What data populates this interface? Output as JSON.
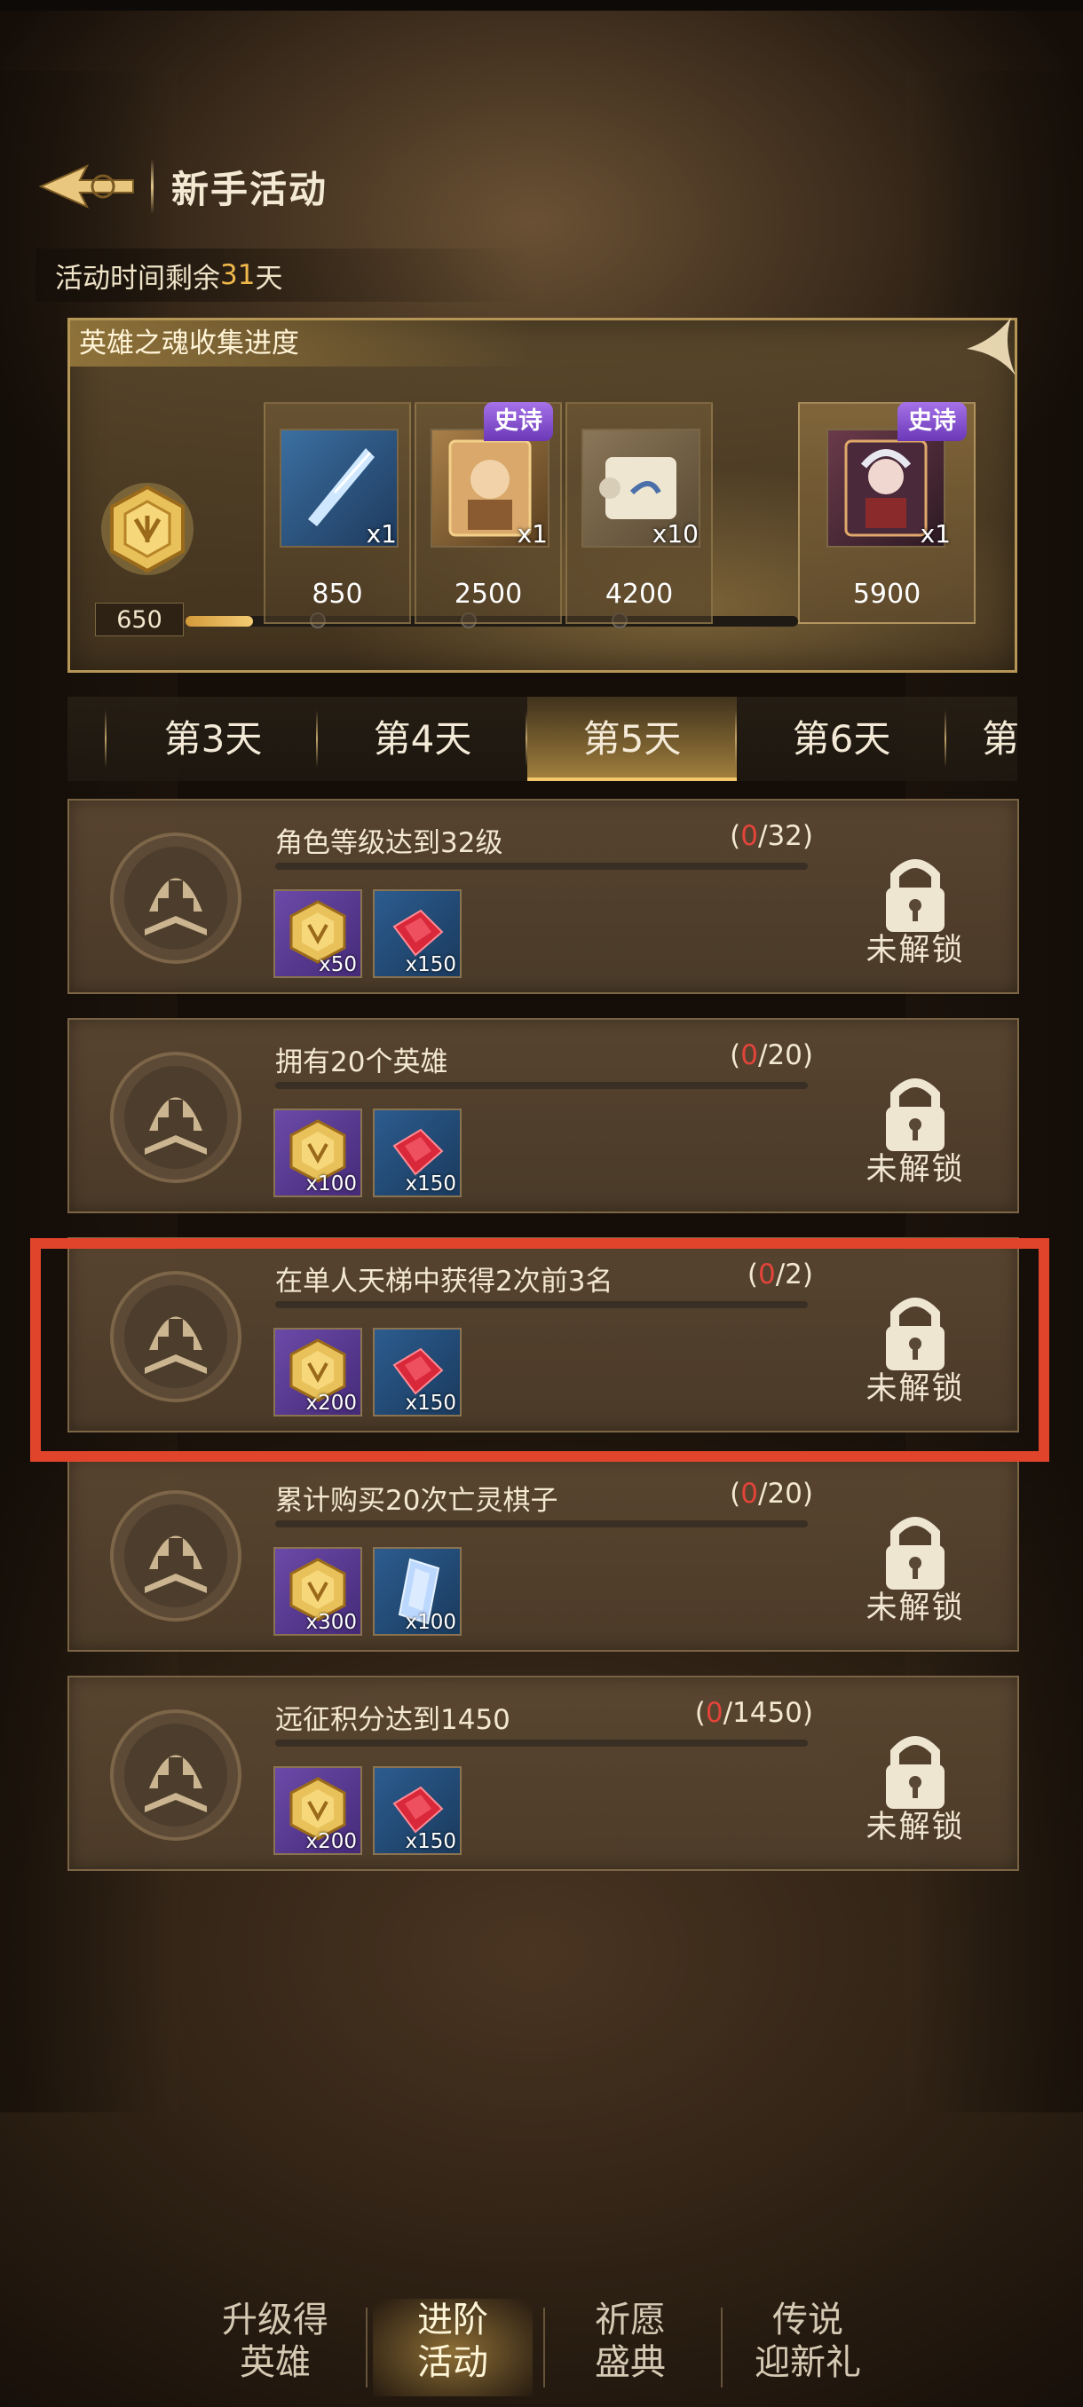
{
  "header": {
    "title": "新手活动"
  },
  "time_bar": {
    "prefix": "活动时间剩余",
    "days": "31",
    "suffix": "天"
  },
  "collection": {
    "title": "英雄之魂收集进度",
    "current": "650",
    "progress": 0.11,
    "rewards": [
      {
        "item": "crystal-shard",
        "qty": "x1",
        "value": "850",
        "badge": ""
      },
      {
        "item": "hero-card",
        "qty": "x1",
        "value": "2500",
        "badge": "史诗"
      },
      {
        "item": "scroll",
        "qty": "x10",
        "value": "4200",
        "badge": ""
      }
    ],
    "final_reward": {
      "item": "hero-card",
      "qty": "x1",
      "value": "5900",
      "badge": "史诗"
    }
  },
  "tabs": [
    "第3天",
    "第4天",
    "第5天",
    "第6天",
    "第"
  ],
  "active_tab": 2,
  "tasks": [
    {
      "title": "角色等级达到32级",
      "cur": "0",
      "total": "/32)",
      "rewards": [
        {
          "type": "coin",
          "qty": "x50"
        },
        {
          "type": "ruby",
          "qty": "x150"
        }
      ],
      "status": "未解锁"
    },
    {
      "title": "拥有20个英雄",
      "cur": "0",
      "total": "/20)",
      "rewards": [
        {
          "type": "coin",
          "qty": "x100"
        },
        {
          "type": "ruby",
          "qty": "x150"
        }
      ],
      "status": "未解锁"
    },
    {
      "title": "在单人天梯中获得2次前3名",
      "cur": "0",
      "total": "/2)",
      "rewards": [
        {
          "type": "coin",
          "qty": "x200"
        },
        {
          "type": "ruby",
          "qty": "x150"
        }
      ],
      "status": "未解锁"
    },
    {
      "title": "累计购买20次亡灵棋子",
      "cur": "0",
      "total": "/20)",
      "rewards": [
        {
          "type": "coin",
          "qty": "x300"
        },
        {
          "type": "crystal",
          "qty": "x100"
        }
      ],
      "status": "未解锁"
    },
    {
      "title": "远征积分达到1450",
      "cur": "0",
      "total": "/1450)",
      "rewards": [
        {
          "type": "coin",
          "qty": "x200"
        },
        {
          "type": "ruby",
          "qty": "x150"
        }
      ],
      "status": "未解锁"
    }
  ],
  "bottom_nav": [
    {
      "line1": "升级得",
      "line2": "英雄"
    },
    {
      "line1": "进阶",
      "line2": "活动"
    },
    {
      "line1": "祈愿",
      "line2": "盛典"
    },
    {
      "line1": "传说",
      "line2": "迎新礼"
    }
  ],
  "active_nav": 1,
  "colors": {
    "accent": "#f0b84a",
    "epic": "#8a55d6",
    "alert": "#e3443a",
    "highlight": "#e0452c"
  }
}
